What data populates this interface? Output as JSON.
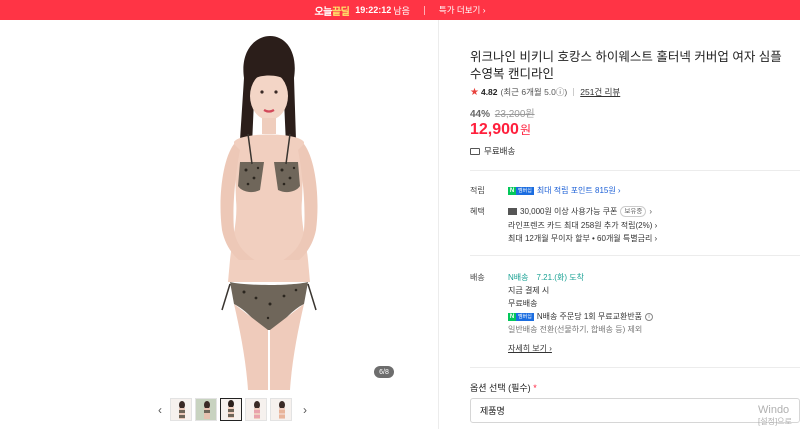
{
  "banner": {
    "deal_prefix": "오늘",
    "deal_highlight": "끝딜",
    "timer": "19:22:12",
    "remaining": "남음",
    "more_deals": "특가 더보기 ›",
    "color": "#ff3445"
  },
  "gallery": {
    "counter": "6/8",
    "prev_icon": "‹",
    "next_icon": "›",
    "thumbnail_count": 5,
    "selected_thumbnail": 3
  },
  "product": {
    "title": "위크나인 비키니 호캉스 하이웨스트 홀터넥 커버업 여자 심플 수영복 캔디라인",
    "rating_star": "★",
    "rating": "4.82",
    "rating_sub": "(최근 6개월 5.0ⓘ)",
    "reviews": "251건 리뷰",
    "discount": "44%",
    "original_price": "23,200원",
    "price": "12,900",
    "price_unit": "원",
    "shipping": "무료배송",
    "accent_color": "#ff1f3c"
  },
  "benefits": {
    "points_label": "적립",
    "npay_n": "N",
    "npay_p": "멤버십",
    "points_text": "최대 적립 포인트 815원 ›",
    "benefit_label": "혜택",
    "coupon_text": "30,000원 이상 사용가능 쿠폰",
    "coupon_pill": "보유중",
    "coupon_chevron": "›",
    "card_text": "라인프렌즈 카드 최대 258원 추가 적립(2%) ›",
    "installment_text": "최대 12개월 무이자 할부 • 60개월 특별금리 ›"
  },
  "delivery": {
    "label": "배송",
    "arrival_prefix": "N배송",
    "arrival": "7.21.(화) 도착",
    "pay_now": "지금 결제 시",
    "free": "무료배송",
    "exchange_text": "N배송 주문당 1회 무료교환반품",
    "info_icon": "i",
    "note": "일반배송 전환(선물하기, 합배송 등) 제외",
    "details": "자세히 보기 ›"
  },
  "options": {
    "label": "옵션 선택 (필수)",
    "required_mark": "*",
    "select_placeholder": "제품명"
  },
  "watermark": {
    "line1": "Windo",
    "line2": "[설정]으로"
  }
}
